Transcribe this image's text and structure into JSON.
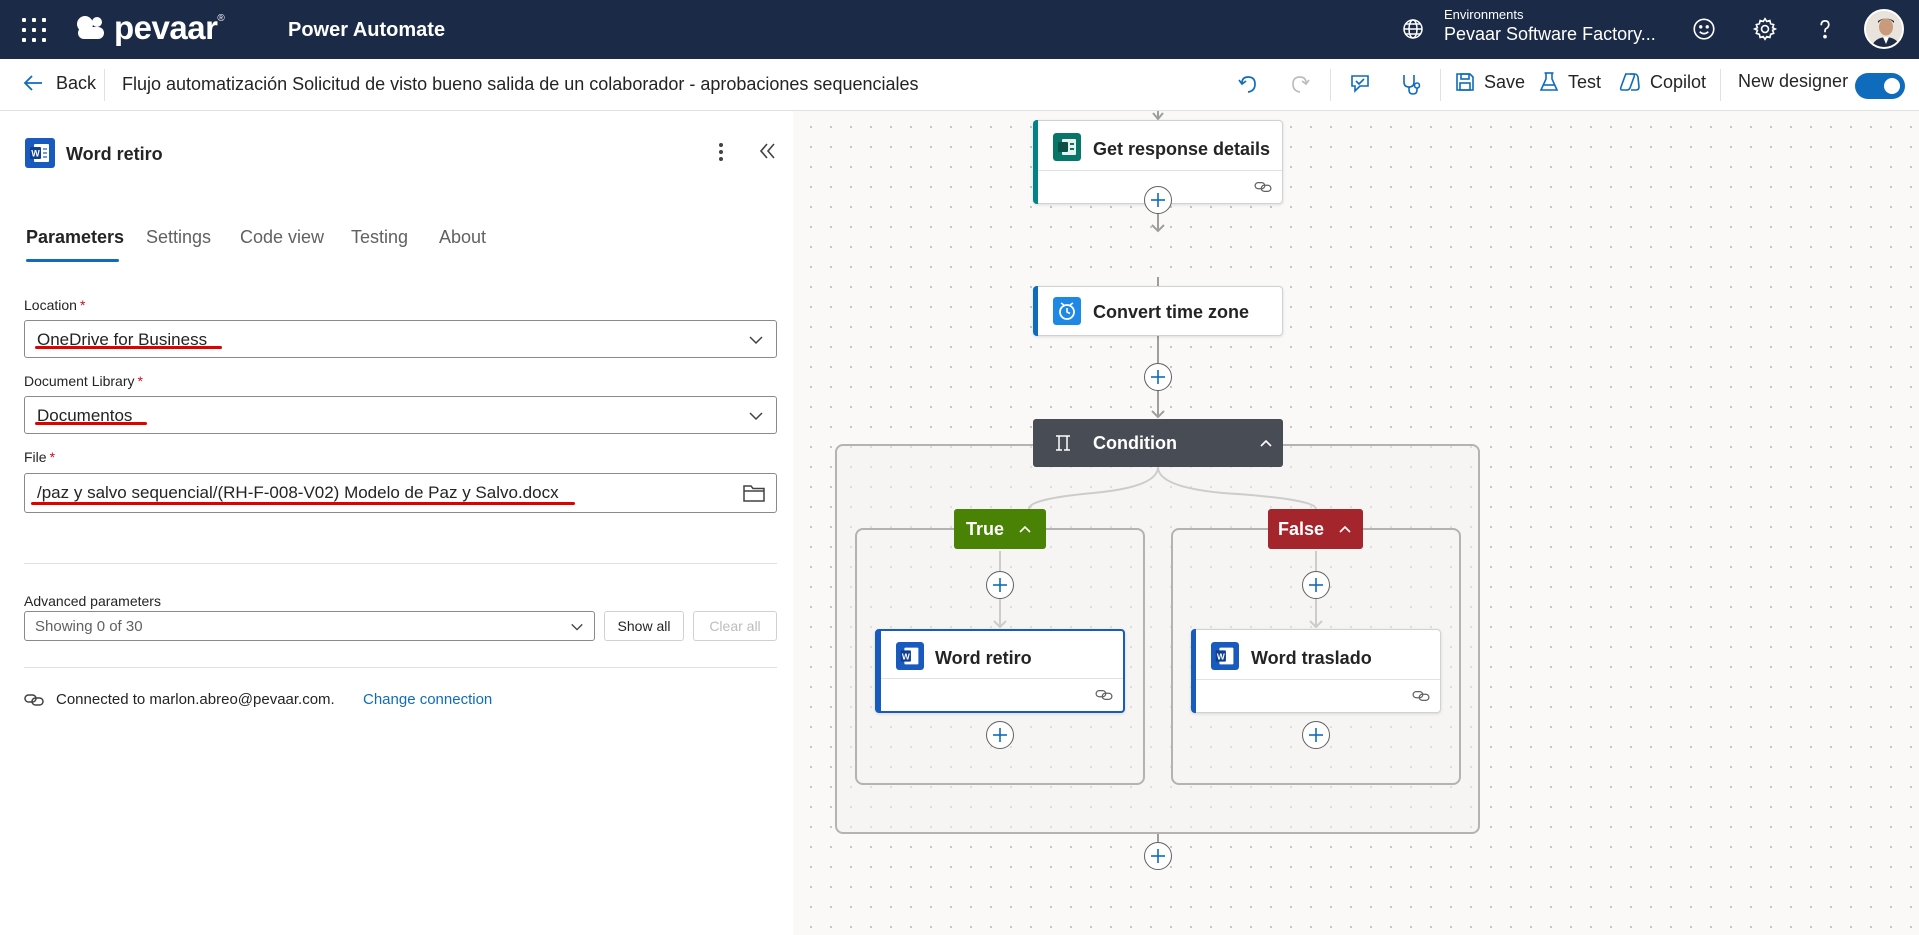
{
  "header": {
    "brand": "pevaar",
    "brand_mark": "®",
    "app_name": "Power Automate",
    "environment_label": "Environments",
    "environment_name": "Pevaar Software Factory..."
  },
  "commandbar": {
    "back_label": "Back",
    "flow_title": "Flujo automatización Solicitud de visto bueno salida de un colaborador - aprobaciones sequenciales",
    "save_label": "Save",
    "test_label": "Test",
    "copilot_label": "Copilot",
    "new_designer_label": "New designer",
    "new_designer_on": true
  },
  "panel": {
    "title": "Word retiro",
    "tabs": [
      {
        "label": "Parameters",
        "active": true
      },
      {
        "label": "Settings",
        "active": false
      },
      {
        "label": "Code view",
        "active": false
      },
      {
        "label": "Testing",
        "active": false
      },
      {
        "label": "About",
        "active": false
      }
    ],
    "fields": {
      "location": {
        "label": "Location",
        "required_mark": "*",
        "value": "OneDrive for Business"
      },
      "library": {
        "label": "Document Library",
        "required_mark": "*",
        "value": "Documentos"
      },
      "file": {
        "label": "File",
        "required_mark": "*",
        "value": "/paz y salvo sequencial/(RH-F-008-V02) Modelo de Paz y Salvo.docx"
      }
    },
    "advanced": {
      "label": "Advanced parameters",
      "select_value": "Showing 0 of 30",
      "show_all": "Show all",
      "clear_all": "Clear all"
    },
    "connection": {
      "text": "Connected to marlon.abreo@pevaar.com.",
      "change_link": "Change connection"
    }
  },
  "canvas": {
    "nodes": {
      "get_response": {
        "label": "Get response details",
        "accent": "#038387"
      },
      "convert_time": {
        "label": "Convert time zone",
        "accent": "#0f6cbd"
      },
      "condition": {
        "label": "Condition"
      },
      "true_branch": {
        "label": "True",
        "color": "#498205"
      },
      "false_branch": {
        "label": "False",
        "color": "#a4262c"
      },
      "word_retiro": {
        "label": "Word retiro",
        "accent": "#185abd",
        "selected": true
      },
      "word_traslado": {
        "label": "Word traslado",
        "accent": "#185abd"
      }
    }
  },
  "colors": {
    "header_bg": "#1b2a47",
    "accent_blue": "#0f6cbd",
    "annotation_red": "#e00000"
  }
}
